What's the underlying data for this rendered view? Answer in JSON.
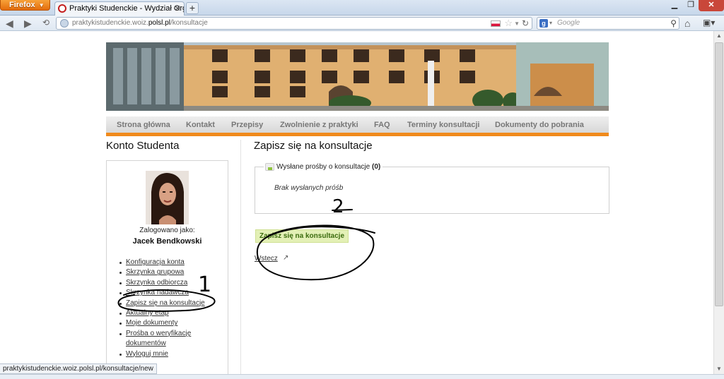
{
  "browser": {
    "app_button": "Firefox",
    "tab_title": "Praktyki Studenckie - Wydział Organizacji...",
    "url_prefix": "praktykistudenckie.woiz.",
    "url_domain": "polsl.pl",
    "url_path": "/konsultacje",
    "search_placeholder": "Google",
    "search_engine_glyph": "g",
    "status_url": "praktykistudenckie.woiz.polsl.pl/konsultacje/new"
  },
  "menu": {
    "items": [
      "Strona główna",
      "Kontakt",
      "Przepisy",
      "Zwolnienie z praktyki",
      "FAQ",
      "Terminy konsultacji",
      "Dokumenty do pobrania"
    ]
  },
  "sidebar": {
    "title": "Konto Studenta",
    "logged_in_label": "Zalogowano jako:",
    "user_name": "Jacek Bendkowski",
    "links": [
      "Konfiguracja konta",
      "Skrzynka grupowa",
      "Skrzynka odbiorcza",
      "Skrzynka nadawcza",
      "Zapisz się na konsultacje",
      "Aktualny etap",
      "Moje dokumenty",
      "Prośba o weryfikację dokumentów",
      "Wyloguj mnie"
    ]
  },
  "main": {
    "title": "Zapisz się na konsultacje",
    "legend_label": "Wysłane prośby o konsultacje",
    "legend_count": "(0)",
    "empty_message": "Brak wysłanych próśb",
    "primary_button": "Zapisz się na konsultacje",
    "back_link": "Wstecz"
  },
  "annotations": {
    "labels": [
      "1",
      "2"
    ]
  },
  "colors": {
    "menu_accent": "#f08a1c",
    "button_bg": "#e3f0b6",
    "button_text": "#3b6b0e"
  }
}
